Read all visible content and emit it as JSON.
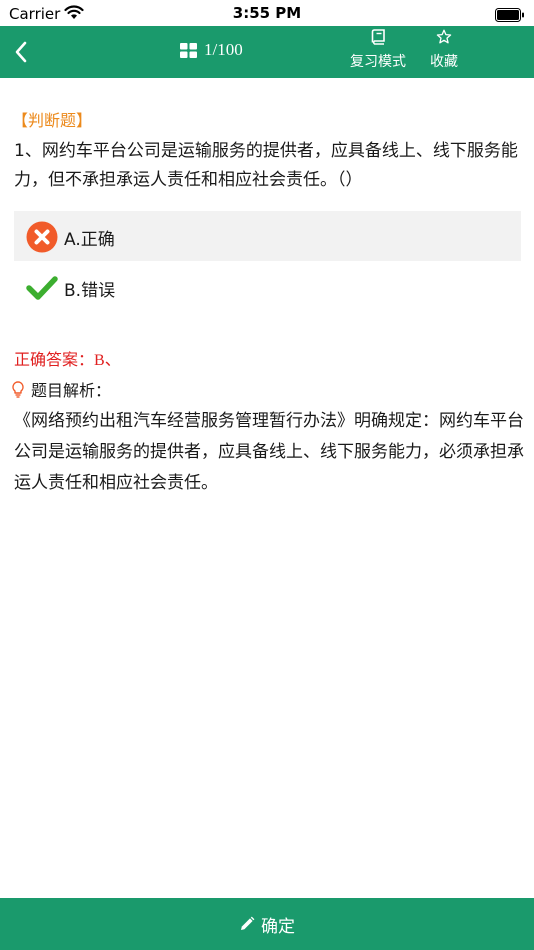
{
  "status_bar": {
    "carrier": "Carrier",
    "time": "3:55 PM"
  },
  "nav": {
    "counter": "1/100",
    "review_mode": "复习模式",
    "favorite": "收藏",
    "bar_color": "#1a9a6c"
  },
  "question": {
    "type": "【判断题】",
    "text": "1、网约车平台公司是运输服务的提供者，应具备线上、线下服务能力，但不承担承运人责任和相应社会责任。（）",
    "options": [
      {
        "label": "A.正确",
        "state": "wrong",
        "icon": "x-circle-icon",
        "color": "#f15b2a"
      },
      {
        "label": "B.错误",
        "state": "correct",
        "icon": "checkmark-icon",
        "color": "#3cae2f"
      }
    ]
  },
  "answer": {
    "label": "正确答案：",
    "value": "B、"
  },
  "analysis": {
    "heading": "题目解析：",
    "text": "《网络预约出租汽车经营服务管理暂行办法》明确规定：网约车平台公司是运输服务的提供者，应具备线上、线下服务能力，必须承担承运人责任和相应社会责任。"
  },
  "footer": {
    "confirm": "确定"
  }
}
